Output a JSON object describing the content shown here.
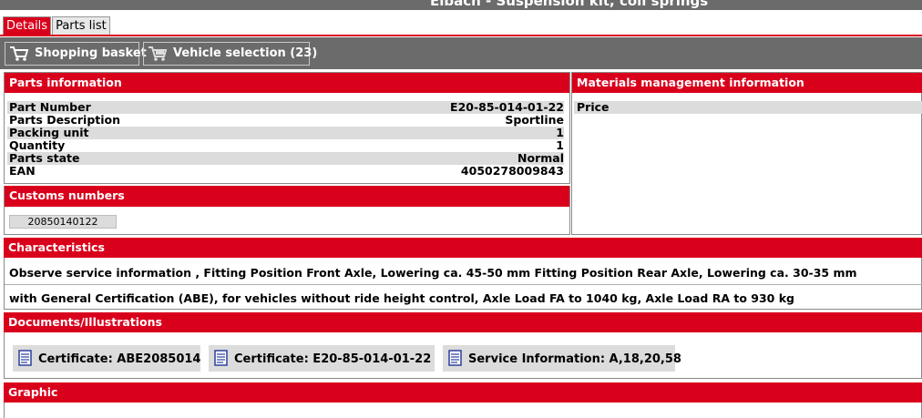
{
  "window": {
    "title": "Eibach - Suspension kit, coil springs"
  },
  "tabs": [
    {
      "label": "Details",
      "active": true
    },
    {
      "label": "Parts list",
      "active": false
    }
  ],
  "toolbar": {
    "shopping_basket": "Shopping basket",
    "vehicle_selection": "Vehicle selection (23)"
  },
  "parts_info": {
    "header": "Parts information",
    "rows": [
      {
        "label": "Part Number",
        "value": "E20-85-014-01-22"
      },
      {
        "label": "Parts Description",
        "value": "Sportline"
      },
      {
        "label": "Packing unit",
        "value": "1"
      },
      {
        "label": "Quantity",
        "value": "1"
      },
      {
        "label": "Parts state",
        "value": "Normal"
      },
      {
        "label": "EAN",
        "value": "4050278009843"
      }
    ]
  },
  "materials": {
    "header": "Materials management information",
    "price_label": "Price"
  },
  "customs": {
    "header": "Customs numbers",
    "number": "20850140122"
  },
  "characteristics": {
    "header": "Characteristics",
    "lines": [
      "Observe service information , Fitting Position Front Axle, Lowering ca. 45-50 mm Fitting Position Rear Axle, Lowering ca. 30-35 mm",
      "with General Certification (ABE), for vehicles without ride height control, Axle Load FA to 1040 kg, Axle Load RA to 930 kg"
    ]
  },
  "documents": {
    "header": "Documents/Illustrations",
    "items": [
      {
        "label": "Certificate: ABE2085014",
        "icon": "document-icon"
      },
      {
        "label": "Certificate: E20-85-014-01-22",
        "icon": "document-icon"
      },
      {
        "label": "Service Information: A,18,20,58",
        "icon": "document-icon"
      }
    ]
  },
  "graphic": {
    "header": "Graphic"
  },
  "colors": {
    "accent_red": "#d9001b",
    "toolbar_gray": "#6b6b6b",
    "row_shade": "#dcdcdc"
  }
}
